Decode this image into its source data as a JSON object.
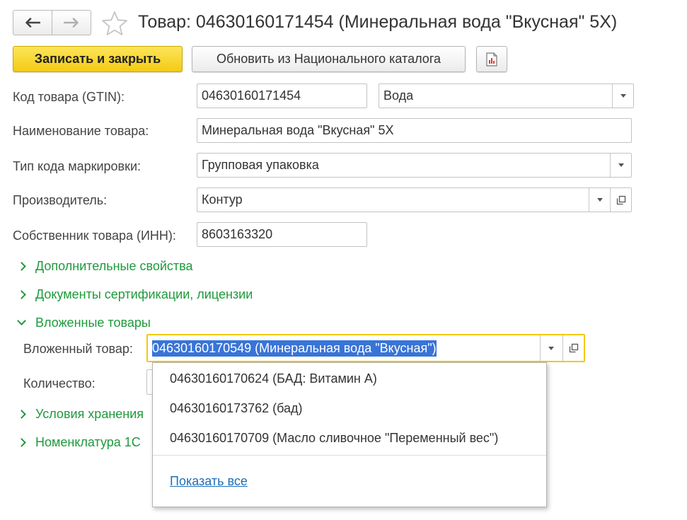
{
  "header": {
    "title": "Товар: 04630160171454 (Минеральная вода \"Вкусная\" 5X)"
  },
  "toolbar": {
    "save_close_label": "Записать и закрыть",
    "refresh_label": "Обновить из Национального каталога"
  },
  "form": {
    "gtin": {
      "label": "Код товара (GTIN):",
      "value": "04630160171454"
    },
    "category": {
      "value": "Вода"
    },
    "name": {
      "label": "Наименование товара:",
      "value": "Минеральная вода \"Вкусная\" 5X"
    },
    "marking_type": {
      "label": "Тип кода маркировки:",
      "value": "Групповая упаковка"
    },
    "manufacturer": {
      "label": "Производитель:",
      "value": "Контур"
    },
    "owner_inn": {
      "label": "Собственник товара (ИНН):",
      "value": "8603163320"
    }
  },
  "sections": {
    "additional": "Дополнительные свойства",
    "certificates": "Документы сертификации, лицензии",
    "nested": "Вложенные товары",
    "storage": "Условия хранения",
    "nomenclature": "Номенклатура 1С"
  },
  "nested": {
    "item_label": "Вложенный товар:",
    "item_value": "04630160170549 (Минеральная вода \"Вкусная\")",
    "quantity_label": "Количество:"
  },
  "popup": {
    "items": [
      "04630160170624 (БАД: Витамин А)",
      "04630160173762 (бад)",
      "04630160170709 (Масло сливочное \"Переменный вес\")"
    ],
    "show_all": "Показать все"
  },
  "colors": {
    "primary_button": "#f5d028",
    "section_green": "#1e9a3c",
    "focus_border": "#f2c816",
    "selection": "#3874d8",
    "link": "#1d6fb8"
  }
}
